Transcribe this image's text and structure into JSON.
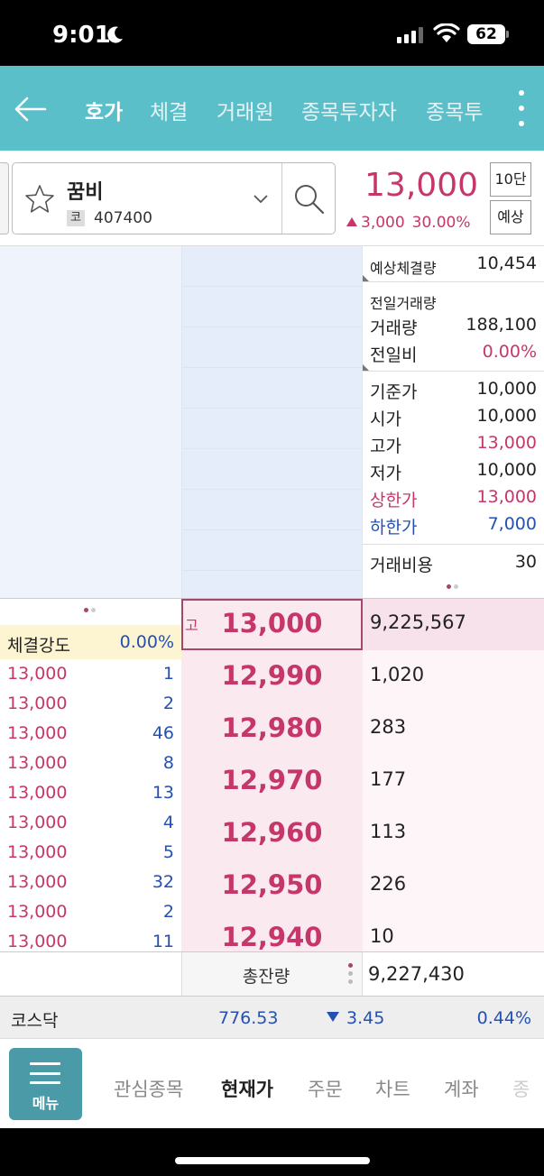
{
  "status_bar": {
    "time": "9:01",
    "battery": "62"
  },
  "header": {
    "tabs": [
      {
        "label": "호가",
        "active": true
      },
      {
        "label": "체결",
        "active": false
      },
      {
        "label": "거래원",
        "active": false
      },
      {
        "label": "종목투자자",
        "active": false
      },
      {
        "label": "종목투",
        "active": false
      }
    ]
  },
  "stock": {
    "name": "꿈비",
    "market_badge": "코",
    "code": "407400",
    "price": "13,000",
    "change": "3,000",
    "change_pct": "30.00%",
    "depth_button": "10단",
    "expected_button": "예상"
  },
  "info": {
    "expected_volume_label": "예상체결량",
    "expected_volume": "10,454",
    "prev_day_title": "전일거래량",
    "volume_label": "거래량",
    "volume": "188,100",
    "prev_ratio_label": "전일비",
    "prev_ratio": "0.00%",
    "base_price_label": "기준가",
    "base_price": "10,000",
    "open_label": "시가",
    "open": "10,000",
    "high_label": "고가",
    "high": "13,000",
    "low_label": "저가",
    "low": "10,000",
    "upper_limit_label": "상한가",
    "upper_limit": "13,000",
    "lower_limit_label": "하한가",
    "lower_limit": "7,000",
    "fee_label": "거래비용",
    "fee": "30"
  },
  "strength": {
    "label": "체결강도",
    "value": "0.00%"
  },
  "trades": [
    {
      "price": "13,000",
      "qty": "1"
    },
    {
      "price": "13,000",
      "qty": "2"
    },
    {
      "price": "13,000",
      "qty": "46"
    },
    {
      "price": "13,000",
      "qty": "8"
    },
    {
      "price": "13,000",
      "qty": "13"
    },
    {
      "price": "13,000",
      "qty": "4"
    },
    {
      "price": "13,000",
      "qty": "5"
    },
    {
      "price": "13,000",
      "qty": "32"
    },
    {
      "price": "13,000",
      "qty": "2"
    },
    {
      "price": "13,000",
      "qty": "11"
    }
  ],
  "asks": [
    {
      "price": "13,000",
      "qty": "9,225,567"
    },
    {
      "price": "12,990",
      "qty": "1,020"
    },
    {
      "price": "12,980",
      "qty": "283"
    },
    {
      "price": "12,970",
      "qty": "177"
    },
    {
      "price": "12,960",
      "qty": "113"
    },
    {
      "price": "12,950",
      "qty": "226"
    },
    {
      "price": "12,940",
      "qty": "10"
    }
  ],
  "high_badge": "고",
  "total": {
    "label": "총잔량",
    "value": "9,227,430"
  },
  "index": {
    "name": "코스닥",
    "value": "776.53",
    "change": "3.45",
    "pct": "0.44%"
  },
  "bottom_nav": {
    "menu_label": "메뉴",
    "items": [
      {
        "label": "관심종목",
        "active": false
      },
      {
        "label": "현재가",
        "active": true
      },
      {
        "label": "주문",
        "active": false
      },
      {
        "label": "차트",
        "active": false
      },
      {
        "label": "계좌",
        "active": false
      },
      {
        "label": "종",
        "active": false
      }
    ]
  },
  "colors": {
    "accent": "#5bbfca",
    "up": "#c5376a",
    "down": "#2450b2",
    "menu": "#4b9aa8"
  }
}
